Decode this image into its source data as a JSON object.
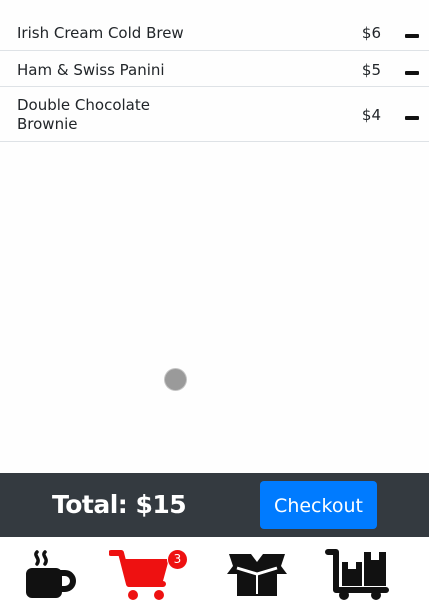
{
  "cart": {
    "items": [
      {
        "name": "Irish Cream Cold Brew",
        "price": "$6"
      },
      {
        "name": "Ham & Swiss Panini",
        "price": "$5"
      },
      {
        "name": "Double Chocolate Brownie",
        "price": "$4"
      }
    ]
  },
  "footer": {
    "total_label": "Total: $15",
    "checkout_label": "Checkout"
  },
  "nav": {
    "items": [
      {
        "icon": "coffee-mug-icon",
        "color": "#111111"
      },
      {
        "icon": "shopping-cart-icon",
        "color": "#ee1111",
        "badge": "3"
      },
      {
        "icon": "open-box-icon",
        "color": "#111111"
      },
      {
        "icon": "dolly-boxes-icon",
        "color": "#111111"
      }
    ]
  },
  "colors": {
    "total_bar": "#343a40",
    "checkout_button": "#007bff",
    "cart_active": "#ee1111"
  }
}
